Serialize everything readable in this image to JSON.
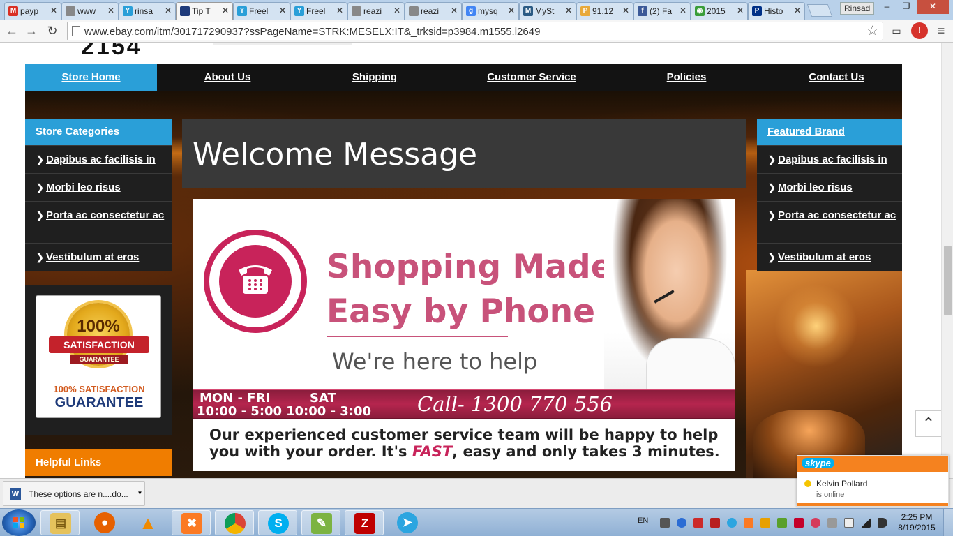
{
  "browser": {
    "tabs": [
      {
        "label": "payp",
        "icon": "gmail-icon",
        "color": "#d93025",
        "glyph": "M"
      },
      {
        "label": "www",
        "icon": "page-icon",
        "color": "#888888",
        "glyph": ""
      },
      {
        "label": "rinsa",
        "icon": "freelancer-icon",
        "color": "#2a9fd8",
        "glyph": "Y"
      },
      {
        "label": "Tip T",
        "icon": "shop-icon",
        "color": "#1f3b7a",
        "glyph": "",
        "active": true
      },
      {
        "label": "Freel",
        "icon": "freelancer-icon",
        "color": "#2a9fd8",
        "glyph": "Y"
      },
      {
        "label": "Freel",
        "icon": "freelancer-icon",
        "color": "#2a9fd8",
        "glyph": "Y"
      },
      {
        "label": "reazi",
        "icon": "page-icon",
        "color": "#888888",
        "glyph": ""
      },
      {
        "label": "reazi",
        "icon": "page-icon",
        "color": "#888888",
        "glyph": ""
      },
      {
        "label": "mysq",
        "icon": "google-icon",
        "color": "#4285f4",
        "glyph": "g"
      },
      {
        "label": "MySt",
        "icon": "mysql-icon",
        "color": "#2b5b84",
        "glyph": "M"
      },
      {
        "label": "91.12",
        "icon": "pma-icon",
        "color": "#e8a93a",
        "glyph": "P"
      },
      {
        "label": "(2) Fa",
        "icon": "facebook-icon",
        "color": "#3b5998",
        "glyph": "f"
      },
      {
        "label": "2015",
        "icon": "sync-icon",
        "color": "#3a9d3a",
        "glyph": "◉"
      },
      {
        "label": "Histo",
        "icon": "paypal-icon",
        "color": "#003087",
        "glyph": "P"
      }
    ],
    "profile_name": "Rinsad",
    "url": "www.ebay.com/itm/301717290937?ssPageName=STRK:MESELX:IT&_trksid=p3984.m1555.l2649"
  },
  "store": {
    "logo_fragment": "2154",
    "nav": [
      "Store Home",
      "About Us",
      "Shipping",
      "Customer Service",
      "Policies",
      "Contact Us"
    ],
    "categories_heading": "Store Categories",
    "categories": [
      "Dapibus ac facilisis in",
      "Morbi leo risus",
      "Porta ac consectetur ac",
      "Vestibulum at eros"
    ],
    "featured_heading": "Featured Brand",
    "featured": [
      "Dapibus ac facilisis in",
      "Morbi leo risus",
      "Porta ac consectetur ac",
      "Vestibulum at eros"
    ],
    "welcome_title": "Welcome Message",
    "banner": {
      "title_line1": "Shopping Made",
      "title_line2": "Easy by Phone",
      "tagline": "We're here to help",
      "days1": "MON - FRI",
      "hours1": "10:00 - 5:00",
      "days2": "SAT",
      "hours2": "10:00 - 3:00",
      "call": "Call- 1300 770 556",
      "desc_before": "Our experienced customer service team will be happy to help you with your order. It's ",
      "desc_fast": "FAST",
      "desc_after": ", easy and only takes 3 minutes."
    },
    "guarantee": {
      "seal_text": "100%",
      "ribbon": "SATISFACTION",
      "ribbon_sub": "GUARANTEE",
      "line1": "100% SATISFACTION",
      "line2": "GUARANTEE"
    },
    "helpful_heading": "Helpful Links",
    "colors": {
      "accent_blue": "#2a9fd8",
      "accent_orange": "#f07d00",
      "brand_pink": "#c8235a"
    }
  },
  "download": {
    "filename": "These options are n....do..."
  },
  "skype": {
    "logo": "skype",
    "contact": "Kelvin Pollard",
    "status": "is online"
  },
  "taskbar": {
    "apps": [
      "explorer",
      "firefox",
      "vlc",
      "xampp",
      "chrome",
      "skype",
      "notepad",
      "filezilla",
      "telegram"
    ],
    "language": "EN",
    "time": "2:25 PM",
    "date": "8/19/2015"
  }
}
